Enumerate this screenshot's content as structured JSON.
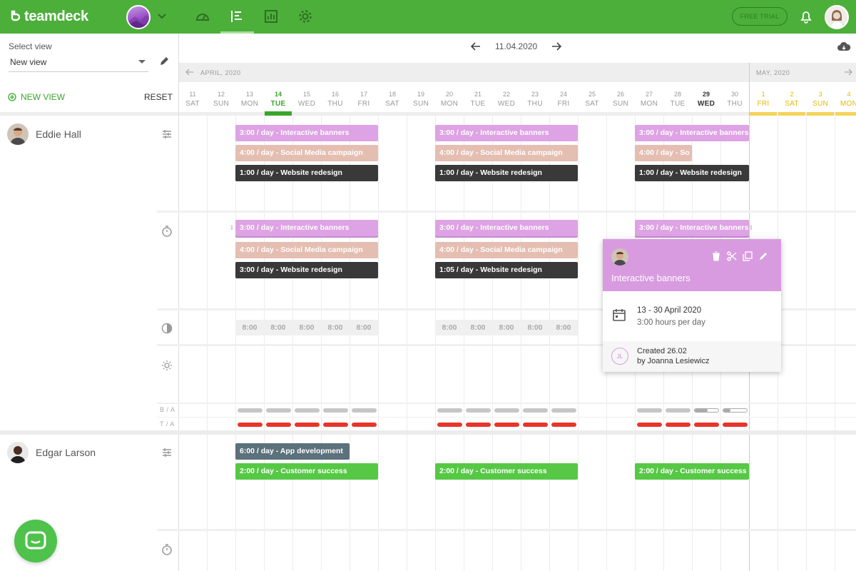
{
  "app": {
    "logo_text": "teamdeck",
    "free_trial_label": "FREE TRIAL"
  },
  "colors": {
    "brand_green": "#4caf3a",
    "purple": "#dea3e4",
    "tan": "#e5beb2",
    "dark": "#393939",
    "green_bar": "#56c845",
    "slate": "#5b717c",
    "red": "#e8352a"
  },
  "nav": {
    "icons": [
      "dashboard-icon",
      "schedule-icon",
      "reports-icon",
      "settings-icon"
    ],
    "active": "schedule-icon"
  },
  "sidebar": {
    "select_view_label": "Select view",
    "selected_view": "New view",
    "new_view_label": "NEW VIEW",
    "reset_label": "RESET"
  },
  "date_nav": {
    "current_date": "11.04.2020"
  },
  "months": [
    {
      "label": "APRIL, 2020"
    },
    {
      "label": "MAY, 2020"
    }
  ],
  "days": [
    {
      "n": "11",
      "w": "SAT"
    },
    {
      "n": "12",
      "w": "SUN"
    },
    {
      "n": "13",
      "w": "MON"
    },
    {
      "n": "14",
      "w": "TUE",
      "today": true
    },
    {
      "n": "15",
      "w": "WED"
    },
    {
      "n": "16",
      "w": "THU"
    },
    {
      "n": "17",
      "w": "FRI"
    },
    {
      "n": "18",
      "w": "SAT"
    },
    {
      "n": "19",
      "w": "SUN"
    },
    {
      "n": "20",
      "w": "MON"
    },
    {
      "n": "21",
      "w": "TUE"
    },
    {
      "n": "22",
      "w": "WED"
    },
    {
      "n": "23",
      "w": "THU"
    },
    {
      "n": "24",
      "w": "FRI"
    },
    {
      "n": "25",
      "w": "SAT"
    },
    {
      "n": "26",
      "w": "SUN"
    },
    {
      "n": "27",
      "w": "MON"
    },
    {
      "n": "28",
      "w": "TUE"
    },
    {
      "n": "29",
      "w": "WED",
      "bold": true
    },
    {
      "n": "30",
      "w": "THU"
    },
    {
      "n": "1",
      "w": "FRI",
      "may": true
    },
    {
      "n": "2",
      "w": "SAT",
      "may": true
    },
    {
      "n": "3",
      "w": "SUN",
      "may": true
    },
    {
      "n": "4",
      "w": "MON",
      "may": true
    }
  ],
  "people": [
    {
      "name": "Eddie Hall",
      "planned": [
        {
          "label": "3:00 / day - Interactive banners"
        },
        {
          "label": "4:00 / day - Social Media campaign"
        },
        {
          "label": "4:00 / day - So"
        },
        {
          "label": "1:00 / day - Website redesign"
        }
      ],
      "timesheet": [
        {
          "label": "3:00 / day - Interactive banners"
        },
        {
          "label": "4:00 / day - Social Media campaign"
        },
        {
          "label": "3:00 / day - Website redesign"
        },
        {
          "label": "1:05 / day - Website redesign"
        }
      ],
      "capacity": "8:00",
      "ba_label": "B / A",
      "ta_label": "T / A"
    },
    {
      "name": "Edgar Larson",
      "planned": [
        {
          "label": "6:00 / day - App development"
        },
        {
          "label": "2:00 / day - Customer success"
        }
      ]
    }
  ],
  "popup": {
    "title": "Interactive banners",
    "date_range": "13 - 30 April 2020",
    "hours_per_day": "3:00 hours per day",
    "creator_initials": "JL",
    "created_line": "Created 26.02",
    "created_by": "by Joanna Lesiewicz"
  }
}
